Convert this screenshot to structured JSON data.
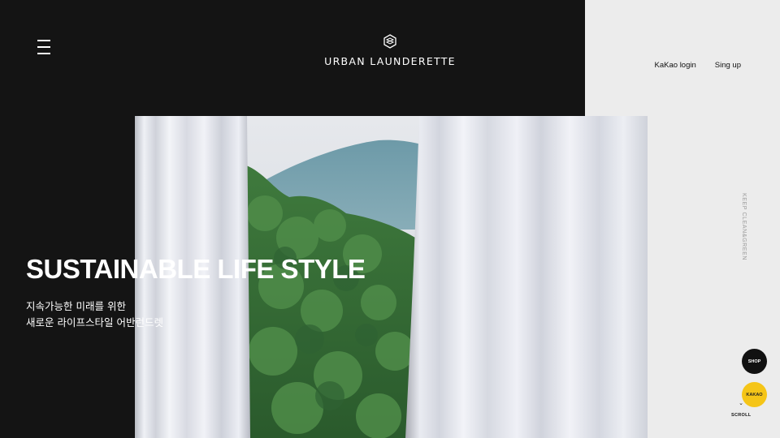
{
  "header": {
    "logo_text": "URBAN LAUNDERETTE",
    "menu_icon": "hamburger-menu-icon"
  },
  "nav": {
    "login_label": "KaKao login",
    "signup_label": "Sing up"
  },
  "hero": {
    "title": "SUSTAINABLE LIFE STYLE",
    "subtitle_line1": "지속가능한 미래를 위한",
    "subtitle_line2": "새로운 라이프스타일 어반런드렛"
  },
  "side": {
    "vertical_tag": "KEEP CLEAN&GREEN"
  },
  "floating": {
    "shop_label": "SHOP",
    "kakao_label": "KAKAO",
    "scroll_arrow": "⌄",
    "scroll_label": "SCROLL"
  },
  "colors": {
    "dark_panel": "#141414",
    "page_bg": "#ececec",
    "kakao_yellow": "#f5c518"
  }
}
